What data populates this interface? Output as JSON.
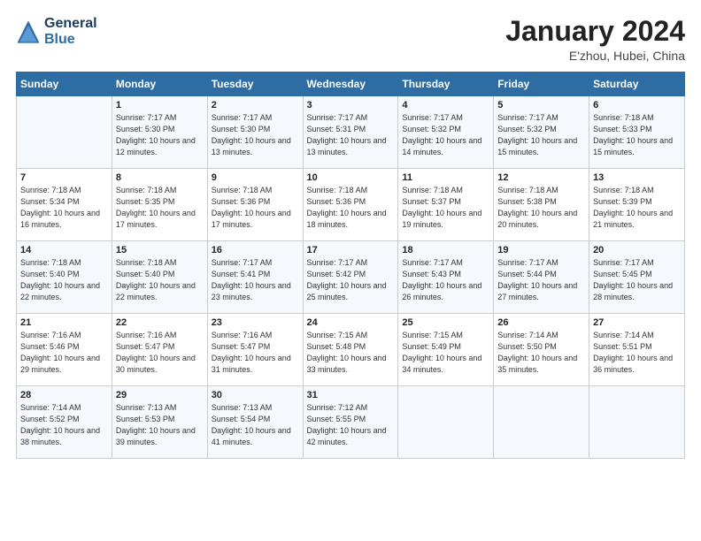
{
  "logo": {
    "line1": "General",
    "line2": "Blue"
  },
  "title": "January 2024",
  "subtitle": "E'zhou, Hubei, China",
  "header": {
    "days": [
      "Sunday",
      "Monday",
      "Tuesday",
      "Wednesday",
      "Thursday",
      "Friday",
      "Saturday"
    ]
  },
  "weeks": [
    {
      "cells": [
        {
          "num": "",
          "sunrise": "",
          "sunset": "",
          "daylight": ""
        },
        {
          "num": "1",
          "sunrise": "Sunrise: 7:17 AM",
          "sunset": "Sunset: 5:30 PM",
          "daylight": "Daylight: 10 hours and 12 minutes."
        },
        {
          "num": "2",
          "sunrise": "Sunrise: 7:17 AM",
          "sunset": "Sunset: 5:30 PM",
          "daylight": "Daylight: 10 hours and 13 minutes."
        },
        {
          "num": "3",
          "sunrise": "Sunrise: 7:17 AM",
          "sunset": "Sunset: 5:31 PM",
          "daylight": "Daylight: 10 hours and 13 minutes."
        },
        {
          "num": "4",
          "sunrise": "Sunrise: 7:17 AM",
          "sunset": "Sunset: 5:32 PM",
          "daylight": "Daylight: 10 hours and 14 minutes."
        },
        {
          "num": "5",
          "sunrise": "Sunrise: 7:17 AM",
          "sunset": "Sunset: 5:32 PM",
          "daylight": "Daylight: 10 hours and 15 minutes."
        },
        {
          "num": "6",
          "sunrise": "Sunrise: 7:18 AM",
          "sunset": "Sunset: 5:33 PM",
          "daylight": "Daylight: 10 hours and 15 minutes."
        }
      ]
    },
    {
      "cells": [
        {
          "num": "7",
          "sunrise": "Sunrise: 7:18 AM",
          "sunset": "Sunset: 5:34 PM",
          "daylight": "Daylight: 10 hours and 16 minutes."
        },
        {
          "num": "8",
          "sunrise": "Sunrise: 7:18 AM",
          "sunset": "Sunset: 5:35 PM",
          "daylight": "Daylight: 10 hours and 17 minutes."
        },
        {
          "num": "9",
          "sunrise": "Sunrise: 7:18 AM",
          "sunset": "Sunset: 5:36 PM",
          "daylight": "Daylight: 10 hours and 17 minutes."
        },
        {
          "num": "10",
          "sunrise": "Sunrise: 7:18 AM",
          "sunset": "Sunset: 5:36 PM",
          "daylight": "Daylight: 10 hours and 18 minutes."
        },
        {
          "num": "11",
          "sunrise": "Sunrise: 7:18 AM",
          "sunset": "Sunset: 5:37 PM",
          "daylight": "Daylight: 10 hours and 19 minutes."
        },
        {
          "num": "12",
          "sunrise": "Sunrise: 7:18 AM",
          "sunset": "Sunset: 5:38 PM",
          "daylight": "Daylight: 10 hours and 20 minutes."
        },
        {
          "num": "13",
          "sunrise": "Sunrise: 7:18 AM",
          "sunset": "Sunset: 5:39 PM",
          "daylight": "Daylight: 10 hours and 21 minutes."
        }
      ]
    },
    {
      "cells": [
        {
          "num": "14",
          "sunrise": "Sunrise: 7:18 AM",
          "sunset": "Sunset: 5:40 PM",
          "daylight": "Daylight: 10 hours and 22 minutes."
        },
        {
          "num": "15",
          "sunrise": "Sunrise: 7:18 AM",
          "sunset": "Sunset: 5:40 PM",
          "daylight": "Daylight: 10 hours and 22 minutes."
        },
        {
          "num": "16",
          "sunrise": "Sunrise: 7:17 AM",
          "sunset": "Sunset: 5:41 PM",
          "daylight": "Daylight: 10 hours and 23 minutes."
        },
        {
          "num": "17",
          "sunrise": "Sunrise: 7:17 AM",
          "sunset": "Sunset: 5:42 PM",
          "daylight": "Daylight: 10 hours and 25 minutes."
        },
        {
          "num": "18",
          "sunrise": "Sunrise: 7:17 AM",
          "sunset": "Sunset: 5:43 PM",
          "daylight": "Daylight: 10 hours and 26 minutes."
        },
        {
          "num": "19",
          "sunrise": "Sunrise: 7:17 AM",
          "sunset": "Sunset: 5:44 PM",
          "daylight": "Daylight: 10 hours and 27 minutes."
        },
        {
          "num": "20",
          "sunrise": "Sunrise: 7:17 AM",
          "sunset": "Sunset: 5:45 PM",
          "daylight": "Daylight: 10 hours and 28 minutes."
        }
      ]
    },
    {
      "cells": [
        {
          "num": "21",
          "sunrise": "Sunrise: 7:16 AM",
          "sunset": "Sunset: 5:46 PM",
          "daylight": "Daylight: 10 hours and 29 minutes."
        },
        {
          "num": "22",
          "sunrise": "Sunrise: 7:16 AM",
          "sunset": "Sunset: 5:47 PM",
          "daylight": "Daylight: 10 hours and 30 minutes."
        },
        {
          "num": "23",
          "sunrise": "Sunrise: 7:16 AM",
          "sunset": "Sunset: 5:47 PM",
          "daylight": "Daylight: 10 hours and 31 minutes."
        },
        {
          "num": "24",
          "sunrise": "Sunrise: 7:15 AM",
          "sunset": "Sunset: 5:48 PM",
          "daylight": "Daylight: 10 hours and 33 minutes."
        },
        {
          "num": "25",
          "sunrise": "Sunrise: 7:15 AM",
          "sunset": "Sunset: 5:49 PM",
          "daylight": "Daylight: 10 hours and 34 minutes."
        },
        {
          "num": "26",
          "sunrise": "Sunrise: 7:14 AM",
          "sunset": "Sunset: 5:50 PM",
          "daylight": "Daylight: 10 hours and 35 minutes."
        },
        {
          "num": "27",
          "sunrise": "Sunrise: 7:14 AM",
          "sunset": "Sunset: 5:51 PM",
          "daylight": "Daylight: 10 hours and 36 minutes."
        }
      ]
    },
    {
      "cells": [
        {
          "num": "28",
          "sunrise": "Sunrise: 7:14 AM",
          "sunset": "Sunset: 5:52 PM",
          "daylight": "Daylight: 10 hours and 38 minutes."
        },
        {
          "num": "29",
          "sunrise": "Sunrise: 7:13 AM",
          "sunset": "Sunset: 5:53 PM",
          "daylight": "Daylight: 10 hours and 39 minutes."
        },
        {
          "num": "30",
          "sunrise": "Sunrise: 7:13 AM",
          "sunset": "Sunset: 5:54 PM",
          "daylight": "Daylight: 10 hours and 41 minutes."
        },
        {
          "num": "31",
          "sunrise": "Sunrise: 7:12 AM",
          "sunset": "Sunset: 5:55 PM",
          "daylight": "Daylight: 10 hours and 42 minutes."
        },
        {
          "num": "",
          "sunrise": "",
          "sunset": "",
          "daylight": ""
        },
        {
          "num": "",
          "sunrise": "",
          "sunset": "",
          "daylight": ""
        },
        {
          "num": "",
          "sunrise": "",
          "sunset": "",
          "daylight": ""
        }
      ]
    }
  ]
}
